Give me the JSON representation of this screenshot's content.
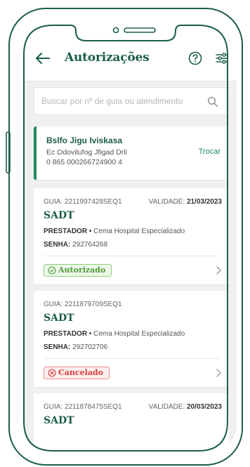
{
  "header": {
    "title": "Autorizações"
  },
  "search": {
    "placeholder": "Buscar por nº de guia ou atendimento"
  },
  "beneficiary": {
    "name": "Bslfo Jigu Iviskasa",
    "plan": "Ec Odovilufog Jfigad Drli",
    "card_number": "0 865 000266724900 4",
    "swap_label": "Trocar"
  },
  "authorizations": [
    {
      "guia": "GUIA: 2211997428SEQ1",
      "validade_label": "VALIDADE:",
      "validade": "21/03/2023",
      "type": "SADT",
      "prestador_label": "PRESTADOR •",
      "prestador": "Cema Hospital Especializado",
      "senha_label": "SENHA:",
      "senha": "292764268",
      "status": "Autorizado"
    },
    {
      "guia": "GUIA: 2211879709SEQ1",
      "type": "SADT",
      "prestador_label": "PRESTADOR •",
      "prestador": "Cema Hospital Especializado",
      "senha_label": "SENHA:",
      "senha": "292702706",
      "status": "Cancelado"
    },
    {
      "guia": "GUIA: 2211878475SEQ1",
      "validade_label": "VALIDADE:",
      "validade": "20/03/2023",
      "type": "SADT"
    }
  ],
  "colors": {
    "brand": "#1b5e45",
    "accent": "#1f8a5e",
    "authorized": "#4e9b39",
    "canceled": "#d83a3a"
  }
}
